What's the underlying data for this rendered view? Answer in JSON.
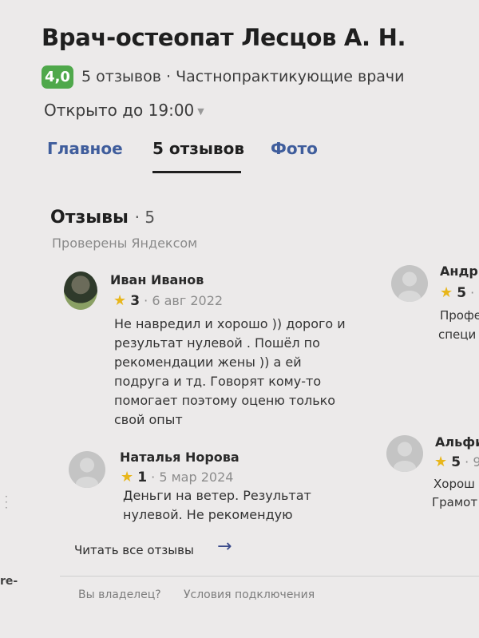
{
  "header": {
    "title": "Врач-остеопат Лесцов А. Н.",
    "rating": "4,0",
    "meta": "5 отзывов · Частнопрактикующие врачи",
    "open_status": "Открыто до 19:00"
  },
  "tabs": [
    {
      "label": "Главное"
    },
    {
      "label": "5 отзывов"
    },
    {
      "label": "Фото"
    }
  ],
  "reviews_section": {
    "heading": "Отзывы",
    "count": "· 5",
    "verified": "Проверены Яндексом"
  },
  "reviews": [
    {
      "name": "Иван Иванов",
      "score": "3",
      "date": "· 6 авг 2022",
      "text": "Не навредил и хорошо )) дорого и результат нулевой . Пошёл по рекомендации жены )) а ей подруга и тд. Говорят кому-то помогает поэтому оценю только свой опыт"
    },
    {
      "name": "Наталья Норова",
      "score": "1",
      "date": "· 5 мар 2024",
      "text": "Деньги на ветер. Результат нулевой. Не рекомендую"
    },
    {
      "name": "Андр",
      "score": "5",
      "date": "·",
      "text_line1": "Профе",
      "text_line2": "специ"
    },
    {
      "name": "Альфи",
      "score": "5",
      "date": "· 9",
      "text_line1": "Хорош",
      "text_line2": "Грамот"
    }
  ],
  "read_all": {
    "label": "Читать все отзывы",
    "arrow": "→"
  },
  "sidebar_fragment": "re-",
  "footer": {
    "owner_link": "Вы владелец?",
    "terms_link": "Условия подключения"
  },
  "colors": {
    "rating_badge": "#4fa84b",
    "tab_link": "#3f5d9c",
    "star": "#e8b61b"
  }
}
